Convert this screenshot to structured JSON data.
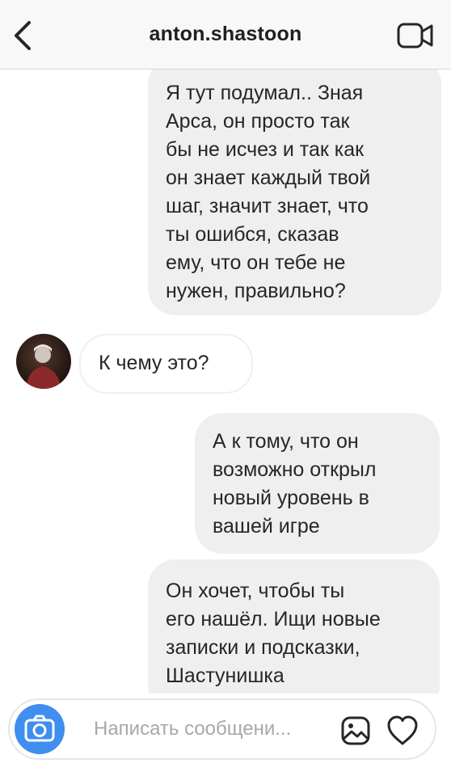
{
  "header": {
    "title": "anton.shastoon",
    "back_icon": "chevron-left-icon",
    "video_icon": "video-camera-icon"
  },
  "messages": [
    {
      "direction": "outgoing",
      "text": "Я тут подумал.. Зная\nАрса, он просто так\nбы не исчез и так как\nон знает каждый твой\nшаг, значит знает, что\nты ошибся, сказав\nему, что он тебе не\nнужен, правильно?"
    },
    {
      "direction": "incoming",
      "text": "К чему это?"
    },
    {
      "direction": "outgoing",
      "text": "А к тому, что он\nвозможно открыл\nновый уровень в\nвашей игре"
    },
    {
      "direction": "outgoing",
      "text": "Он хочет, чтобы ты\nего нашёл. Ищи новые\nзаписки и подсказки,\nШастунишка"
    }
  ],
  "composer": {
    "placeholder": "Написать сообщени...",
    "camera_icon": "camera-icon",
    "gallery_icon": "gallery-icon",
    "like_icon": "heart-icon",
    "camera_color": "#3f8ef0"
  },
  "colors": {
    "outgoing_bubble": "#efefef",
    "incoming_border": "#efefef",
    "header_bg": "#f8f8f8"
  }
}
